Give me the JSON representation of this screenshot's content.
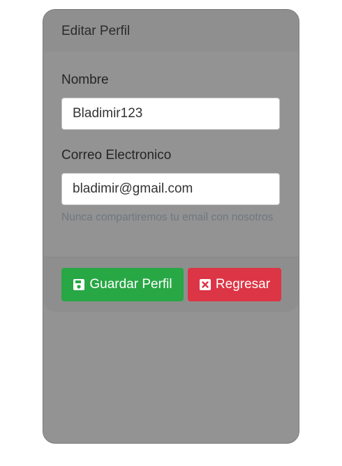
{
  "card": {
    "title": "Editar Perfil"
  },
  "form": {
    "name_label": "Nombre",
    "name_value": "Bladimir123",
    "email_label": "Correo Electronico",
    "email_value": "bladimir@gmail.com",
    "email_help": "Nunca compartiremos tu email con nosotros"
  },
  "actions": {
    "save_label": "Guardar Perfil",
    "save_icon": "floppy-disk-icon",
    "back_label": "Regresar",
    "back_icon": "close-square-icon"
  },
  "colors": {
    "save": "#28a745",
    "back": "#dc3545",
    "card_bg": "#939393"
  }
}
